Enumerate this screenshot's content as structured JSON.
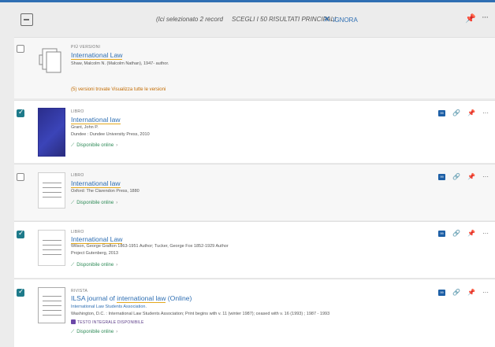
{
  "toolbar": {
    "selected_text": "(Ici selezionato 2 record",
    "choose_text": "SCEGLI I 50 RISULTATI PRINCIPALI",
    "ignore_label": "IGNORA"
  },
  "records": [
    {
      "type": "PIÙ VERSIONI",
      "title": "International Law",
      "meta1": "Shaw, Malcolm N. (Malcolm Nathan), 1947- author.",
      "versions_link": "(5) versioni trovate  Visualizza tutte le versioni",
      "checked": false
    },
    {
      "type": "LIBRO",
      "title": "International law",
      "meta1": "Grant, John P.",
      "meta2": "Dundee : Dundee University Press, 2010",
      "online": "Disponibile online",
      "checked": true
    },
    {
      "type": "LIBRO",
      "title": "International law",
      "meta1": "Oxford: The Clarendon Press, 1880",
      "online": "Disponibile online",
      "checked": false
    },
    {
      "type": "LIBRO",
      "title": "International Law",
      "meta1": "Wilson, George Grafton 1863-1951 Author; Tucker, George Fox 1852-1929 Author",
      "meta2": "Project Gutenberg, 2013",
      "online": "Disponibile online",
      "checked": true
    },
    {
      "type": "RIVISTA",
      "title_pre": "ILSA journal of ",
      "title_hl": "international law",
      "title_post": " (Online)",
      "meta1": "International Law Students Association.",
      "meta2": "Washington, D.C. : International Law Students Association; Print begins with v. 11 (winter 1987); ceased with v. 16 (1993) ; 1987 - 1993",
      "fulltext": "TESTO INTEGRALE DISPONIBILE",
      "online": "Disponibile online",
      "checked": true
    }
  ]
}
